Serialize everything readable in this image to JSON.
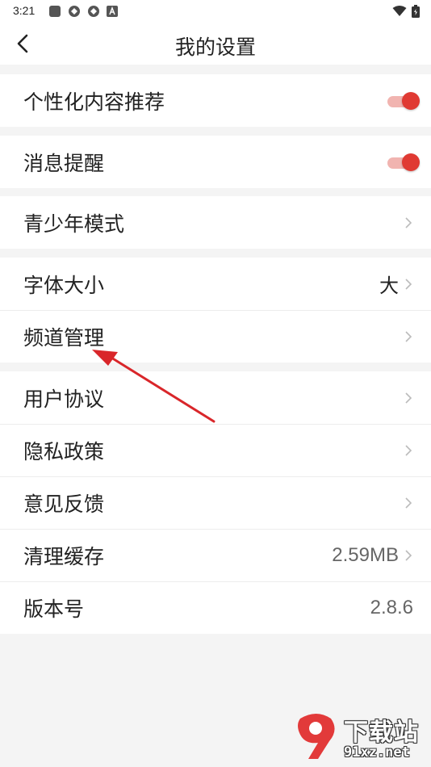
{
  "status_bar": {
    "time": "3:21",
    "left_icons": [
      "square-icon",
      "app-icon",
      "app-icon",
      "a-icon"
    ],
    "right_icons": [
      "wifi-icon",
      "battery-icon"
    ]
  },
  "header": {
    "title": "我的设置",
    "back_icon": "back-arrow-icon"
  },
  "settings": {
    "personalized": {
      "label": "个性化内容推荐",
      "enabled": true
    },
    "notifications": {
      "label": "消息提醒",
      "enabled": true
    },
    "teen_mode": {
      "label": "青少年模式"
    },
    "font_size": {
      "label": "字体大小",
      "value": "大"
    },
    "channel_manage": {
      "label": "频道管理"
    },
    "user_agreement": {
      "label": "用户协议"
    },
    "privacy_policy": {
      "label": "隐私政策"
    },
    "feedback": {
      "label": "意见反馈"
    },
    "clear_cache": {
      "label": "清理缓存",
      "value": "2.59MB"
    },
    "version": {
      "label": "版本号",
      "value": "2.8.6"
    }
  },
  "watermark": {
    "name": "下载站",
    "url": "91xz.net"
  },
  "colors": {
    "accent": "#e03a33",
    "toggle_track": "#f1b4b0",
    "background": "#f4f4f4",
    "annotation_arrow": "#d9262a"
  }
}
